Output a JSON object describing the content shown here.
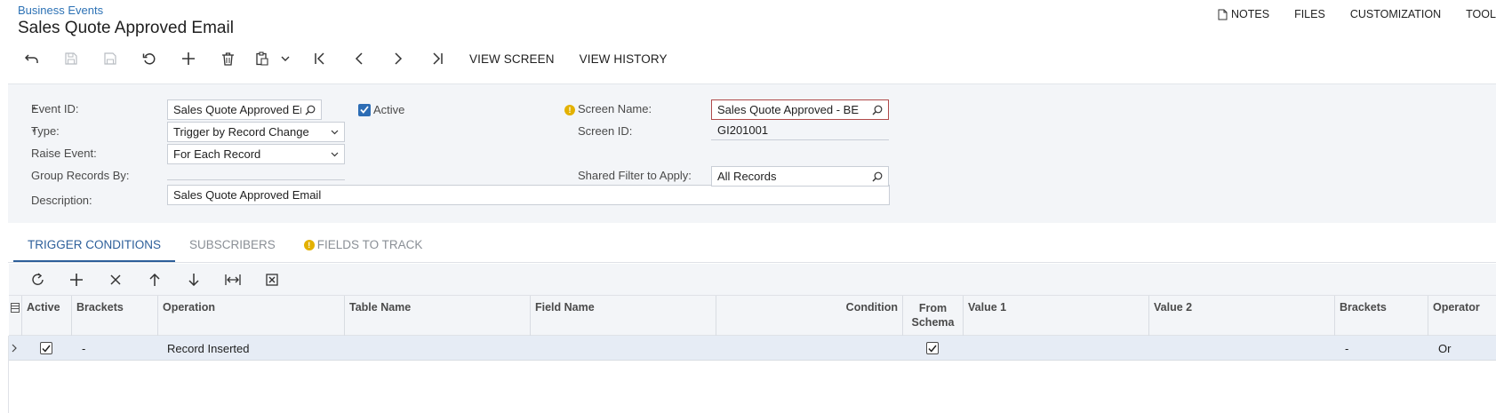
{
  "header": {
    "breadcrumb": "Business Events",
    "title": "Sales Quote Approved Email",
    "links": [
      {
        "label": "NOTES",
        "icon": "note-icon"
      },
      {
        "label": "FILES"
      },
      {
        "label": "CUSTOMIZATION"
      },
      {
        "label": "TOOLS"
      }
    ]
  },
  "toolbar": {
    "icons": [
      "undo-icon",
      "save-icon",
      "save-close-icon",
      "cancel-icon",
      "add-icon",
      "delete-icon",
      "clipboard-icon",
      "chevron-down-icon",
      "first-record-icon",
      "previous-icon",
      "next-icon",
      "last-record-icon"
    ],
    "view_screen": "VIEW SCREEN",
    "view_history": "VIEW HISTORY"
  },
  "form": {
    "event_id_label": "Event ID:",
    "event_id_value": "Sales Quote Approved Email",
    "active_label": "Active",
    "active_checked": true,
    "type_label": "Type:",
    "type_value": "Trigger by Record Change",
    "raise_event_label": "Raise Event:",
    "raise_event_value": "For Each Record",
    "group_records_label": "Group Records By:",
    "group_records_value": "",
    "description_label": "Description:",
    "description_value": "Sales Quote Approved Email",
    "screen_name_label": "Screen Name:",
    "screen_name_value": "Sales Quote Approved - BE",
    "screen_id_label": "Screen ID:",
    "screen_id_value": "GI201001",
    "shared_filter_label": "Shared Filter to Apply:",
    "shared_filter_value": "All Records",
    "required_mark": "*",
    "warning_mark": "!"
  },
  "tabs": [
    {
      "label": "TRIGGER CONDITIONS",
      "active": true
    },
    {
      "label": "SUBSCRIBERS",
      "active": false
    },
    {
      "label": "FIELDS TO TRACK",
      "active": false,
      "warning": true
    }
  ],
  "grid": {
    "toolbar_icons": [
      "refresh-icon",
      "add-row-icon",
      "delete-row-icon",
      "move-up-icon",
      "move-down-icon",
      "fit-columns-icon",
      "export-excel-icon"
    ],
    "columns": [
      "Active",
      "Brackets",
      "Operation",
      "Table Name",
      "Field Name",
      "Condition",
      "From Schema",
      "Value 1",
      "Value 2",
      "Brackets",
      "Operator"
    ],
    "rows": [
      {
        "active": true,
        "brackets_open": "-",
        "operation": "Record Inserted",
        "table_name": "",
        "field_name": "",
        "condition": "",
        "from_schema": true,
        "value1": "",
        "value2": "",
        "brackets_close": "-",
        "operator": "Or"
      }
    ]
  },
  "colors": {
    "accent": "#2d5f9a",
    "link": "#2d72b5",
    "panel": "#f3f5f8",
    "selected_row": "#e6ecf5",
    "error_border": "#b04a4a",
    "warning": "#e3b100"
  }
}
